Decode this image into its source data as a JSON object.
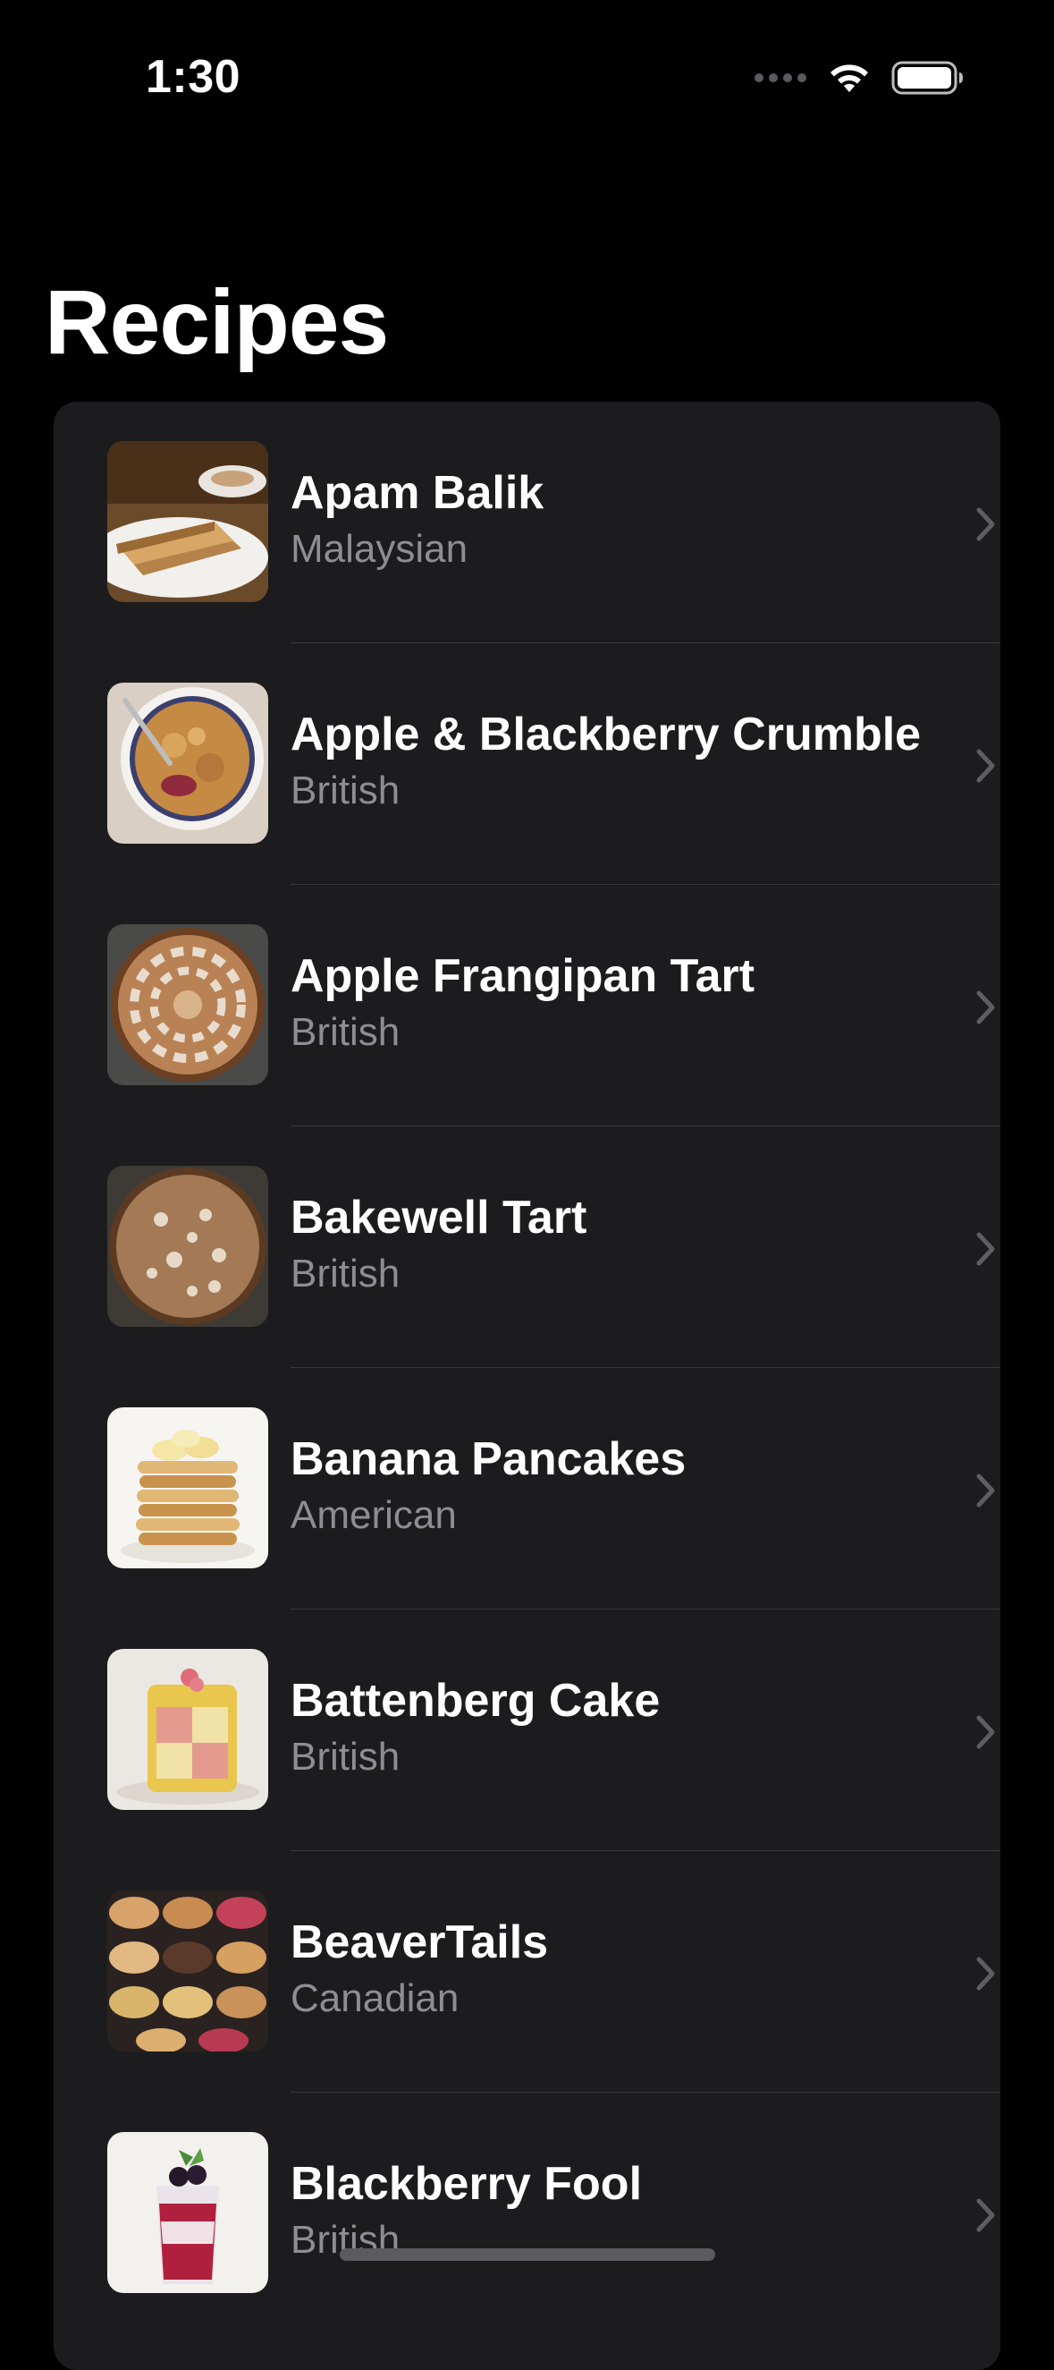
{
  "status_bar": {
    "time": "1:30",
    "signal_icon": "signal-dots-icon",
    "wifi_icon": "wifi-icon",
    "battery_icon": "battery-full-icon"
  },
  "navigation": {
    "title": "Recipes"
  },
  "colors": {
    "background": "#000000",
    "card": "#1c1c1e",
    "secondary_text": "#8d8d93",
    "separator": "#38383a",
    "chevron": "#5e5e62"
  },
  "recipes": [
    {
      "name": "Apam Balik",
      "cuisine": "Malaysian",
      "thumbnail_icon": "apam-balik-photo"
    },
    {
      "name": "Apple & Blackberry Crumble",
      "cuisine": "British",
      "thumbnail_icon": "crumble-photo"
    },
    {
      "name": "Apple Frangipan Tart",
      "cuisine": "British",
      "thumbnail_icon": "frangipan-tart-photo"
    },
    {
      "name": "Bakewell Tart",
      "cuisine": "British",
      "thumbnail_icon": "bakewell-tart-photo"
    },
    {
      "name": "Banana Pancakes",
      "cuisine": "American",
      "thumbnail_icon": "pancakes-photo"
    },
    {
      "name": "Battenberg Cake",
      "cuisine": "British",
      "thumbnail_icon": "battenberg-photo"
    },
    {
      "name": "BeaverTails",
      "cuisine": "Canadian",
      "thumbnail_icon": "beavertails-photo"
    },
    {
      "name": "Blackberry Fool",
      "cuisine": "British",
      "thumbnail_icon": "blackberry-fool-photo"
    }
  ]
}
